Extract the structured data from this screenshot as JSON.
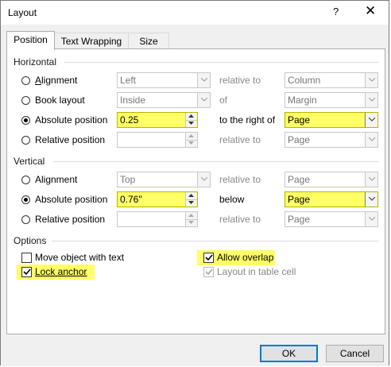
{
  "window": {
    "title": "Layout",
    "help": "?",
    "close": "✕"
  },
  "tabs": [
    {
      "label": "Position",
      "active": true
    },
    {
      "label": "Text Wrapping",
      "active": false
    },
    {
      "label": "Size",
      "active": false
    }
  ],
  "horizontal": {
    "heading": "Horizontal",
    "rows": [
      {
        "label": "Alignment",
        "selected": false,
        "value": "Left",
        "relation": "relative to",
        "target": "Column"
      },
      {
        "label": "Book layout",
        "selected": false,
        "value": "Inside",
        "relation": "of",
        "target": "Margin"
      },
      {
        "label": "Absolute position",
        "selected": true,
        "value": "0.25",
        "relation": "to the right of",
        "target": "Page"
      },
      {
        "label": "Relative position",
        "selected": false,
        "value": "",
        "relation": "relative to",
        "target": "Page"
      }
    ]
  },
  "vertical": {
    "heading": "Vertical",
    "rows": [
      {
        "label": "Alignment",
        "selected": false,
        "value": "Top",
        "relation": "relative to",
        "target": "Page"
      },
      {
        "label": "Absolute position",
        "selected": true,
        "value": "0.76\"",
        "relation": "below",
        "target": "Page"
      },
      {
        "label": "Relative position",
        "selected": false,
        "value": "",
        "relation": "relative to",
        "target": "Page"
      }
    ]
  },
  "options": {
    "heading": "Options",
    "move_object": {
      "label": "Move object with text",
      "checked": false
    },
    "lock_anchor": {
      "label": "Lock anchor",
      "checked": true
    },
    "allow_overlap": {
      "label": "Allow overlap",
      "checked": true
    },
    "layout_in_table": {
      "label": "Layout in table cell",
      "checked": true,
      "disabled": true
    }
  },
  "buttons": {
    "ok": "OK",
    "cancel": "Cancel"
  },
  "colors": {
    "highlight": "#ffff66",
    "accent": "#0078d7",
    "dialog_bg": "#f0f0f0"
  }
}
